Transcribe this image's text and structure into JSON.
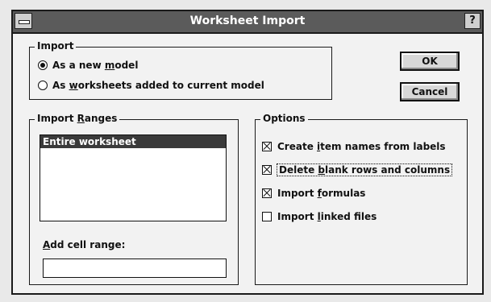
{
  "window": {
    "title": "Worksheet Import",
    "help_label": "?"
  },
  "import_group": {
    "label": "Import",
    "options": [
      {
        "pre": "As a new ",
        "key": "m",
        "post": "odel",
        "selected": true
      },
      {
        "pre": "As ",
        "key": "w",
        "post": "orksheets added to current model",
        "selected": false
      }
    ]
  },
  "buttons": {
    "ok": "OK",
    "cancel": "Cancel"
  },
  "ranges_group": {
    "label_pre": "Import ",
    "label_key": "R",
    "label_post": "anges",
    "list_items": [
      "Entire worksheet"
    ],
    "add_range_pre": "",
    "add_range_key": "A",
    "add_range_post": "dd cell range:",
    "add_range_value": ""
  },
  "options_group": {
    "label": "Options",
    "checkboxes": [
      {
        "pre": "Create ",
        "key": "i",
        "post": "tem names from labels",
        "checked": true
      },
      {
        "pre": "Delete ",
        "key": "b",
        "post": "lank rows and columns",
        "checked": true,
        "focused": true
      },
      {
        "pre": "Import ",
        "key": "f",
        "post": "ormulas",
        "checked": true
      },
      {
        "pre": "Import ",
        "key": "l",
        "post": "inked files",
        "checked": false
      }
    ]
  }
}
